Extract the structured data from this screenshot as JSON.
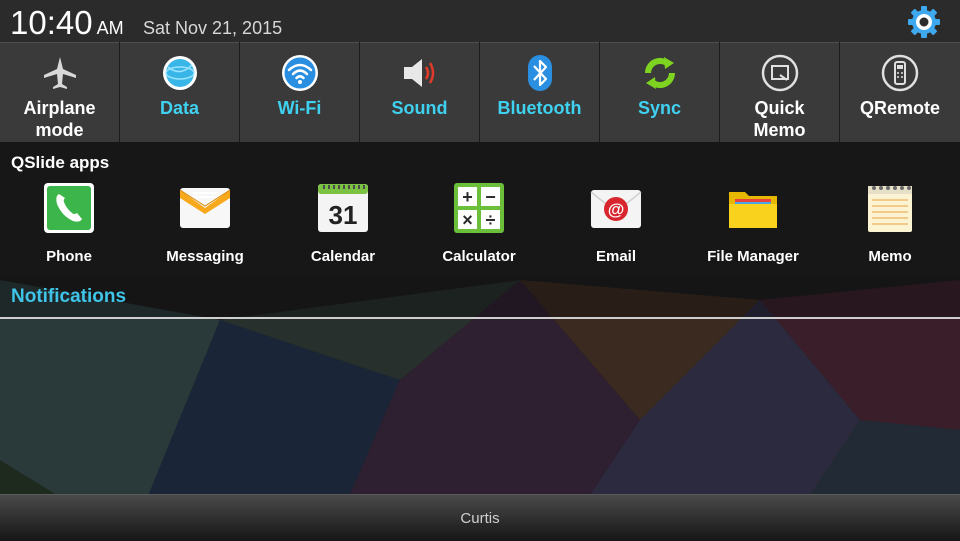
{
  "status": {
    "time": "10:40",
    "ampm": "AM",
    "date": "Sat Nov 21, 2015"
  },
  "quick_settings": [
    {
      "label_lines": [
        "Airplane",
        "mode"
      ],
      "state": "off",
      "icon": "airplane-icon"
    },
    {
      "label_lines": [
        "Data"
      ],
      "state": "on",
      "icon": "globe-icon"
    },
    {
      "label_lines": [
        "Wi-Fi"
      ],
      "state": "on",
      "icon": "wifi-icon"
    },
    {
      "label_lines": [
        "Sound"
      ],
      "state": "on",
      "icon": "speaker-icon"
    },
    {
      "label_lines": [
        "Bluetooth"
      ],
      "state": "on",
      "icon": "bluetooth-icon"
    },
    {
      "label_lines": [
        "Sync"
      ],
      "state": "on",
      "icon": "sync-icon"
    },
    {
      "label_lines": [
        "Quick",
        "Memo"
      ],
      "state": "off",
      "icon": "quick-memo-icon"
    },
    {
      "label_lines": [
        "QRemote"
      ],
      "state": "off",
      "icon": "remote-icon"
    }
  ],
  "qslide": {
    "title": "QSlide apps",
    "apps": [
      {
        "label": "Phone",
        "icon": "phone-icon"
      },
      {
        "label": "Messaging",
        "icon": "envelope-icon"
      },
      {
        "label": "Calendar",
        "icon": "calendar-icon",
        "badge": "31"
      },
      {
        "label": "Calculator",
        "icon": "calculator-icon",
        "symbols": [
          "+",
          "−",
          "×",
          "÷"
        ]
      },
      {
        "label": "Email",
        "icon": "email-icon",
        "symbol": "@"
      },
      {
        "label": "File Manager",
        "icon": "folder-icon"
      },
      {
        "label": "Memo",
        "icon": "notepad-icon"
      }
    ]
  },
  "notifications": {
    "title": "Notifications"
  },
  "bottom": {
    "label": "Curtis"
  },
  "colors": {
    "accent_on": "#3fd1f0",
    "notif_title": "#3fc3e8",
    "tile_bg": "#3a3a3a"
  }
}
